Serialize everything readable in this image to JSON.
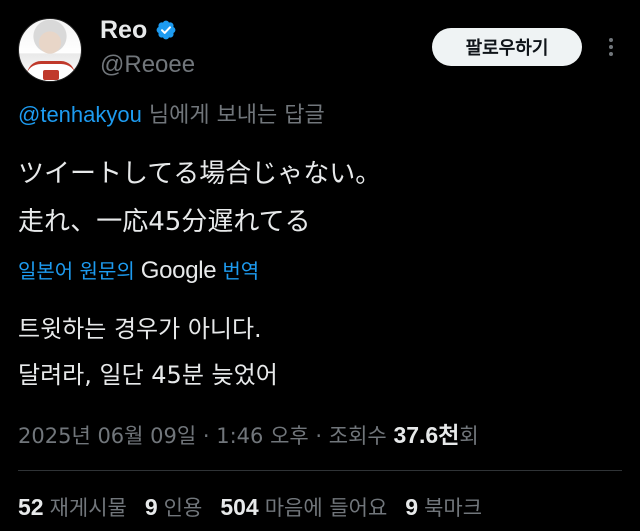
{
  "author": {
    "display_name": "Reo",
    "handle": "@Reoee",
    "verified": true,
    "avatar_icon": "profile-photo"
  },
  "actions": {
    "follow_label": "팔로우하기",
    "more_icon": "more-options-icon"
  },
  "reply": {
    "mention": "@tenhakyou",
    "suffix": " 님에게 보내는 답글"
  },
  "tweet": {
    "line1": "ツイートしてる場合じゃない。",
    "line2": "走れ、一応45分遅れてる"
  },
  "translate": {
    "prefix": "일본어 원문의",
    "provider": "Google",
    "suffix": "번역"
  },
  "translation": {
    "line1": "트윗하는 경우가 아니다.",
    "line2": "달려라, 일단 45분 늦었어"
  },
  "meta": {
    "date": "2025년 06월 09일",
    "time": "1:46 오후",
    "views_label": "조회수",
    "views_value": "37.6천",
    "views_unit": "회"
  },
  "stats": {
    "retweets": "52",
    "retweets_label": "재게시물",
    "quotes": "9",
    "quotes_label": "인용",
    "likes": "504",
    "likes_label": "마음에 들어요",
    "bookmarks": "9",
    "bookmarks_label": "북마크"
  },
  "colors": {
    "background": "#000000",
    "text": "#e7e9ea",
    "secondary": "#71767b",
    "accent": "#1d9bf0"
  }
}
